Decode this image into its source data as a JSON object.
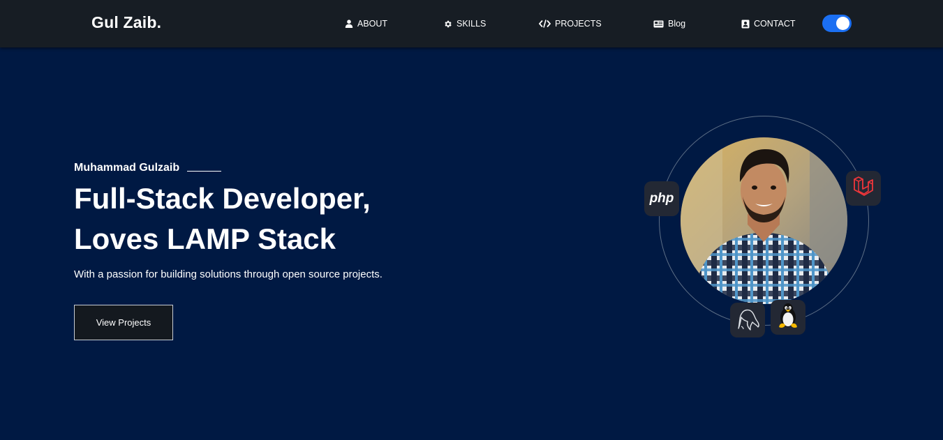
{
  "brand": {
    "name": "Gul Zaib."
  },
  "nav": {
    "items": [
      {
        "label": "ABOUT",
        "icon": "user-icon"
      },
      {
        "label": "SKILLS",
        "icon": "gear-icon"
      },
      {
        "label": "PROJECTS",
        "icon": "code-icon"
      },
      {
        "label": "Blog",
        "icon": "newspaper-icon"
      },
      {
        "label": "CONTACT",
        "icon": "contact-card-icon"
      }
    ],
    "theme_toggle": {
      "state": "on",
      "color": "#1b6ff2"
    }
  },
  "hero": {
    "name": "Muhammad Gulzaib",
    "title_line1": "Full-Stack Developer,",
    "title_line2": "Loves LAMP Stack",
    "subtitle": "With a passion for building solutions through open source projects.",
    "cta_label": "View Projects"
  },
  "tech_badges": {
    "php": {
      "label": "php",
      "icon": "php-logo-icon"
    },
    "laravel": {
      "icon": "laravel-logo-icon"
    },
    "mysql": {
      "icon": "mysql-dolphin-icon"
    },
    "linux": {
      "icon": "linux-tux-icon"
    }
  },
  "colors": {
    "navbar_bg": "#171d24",
    "hero_bg": "#001943",
    "accent": "#1b6ff2",
    "laravel_red": "#f0363b"
  }
}
